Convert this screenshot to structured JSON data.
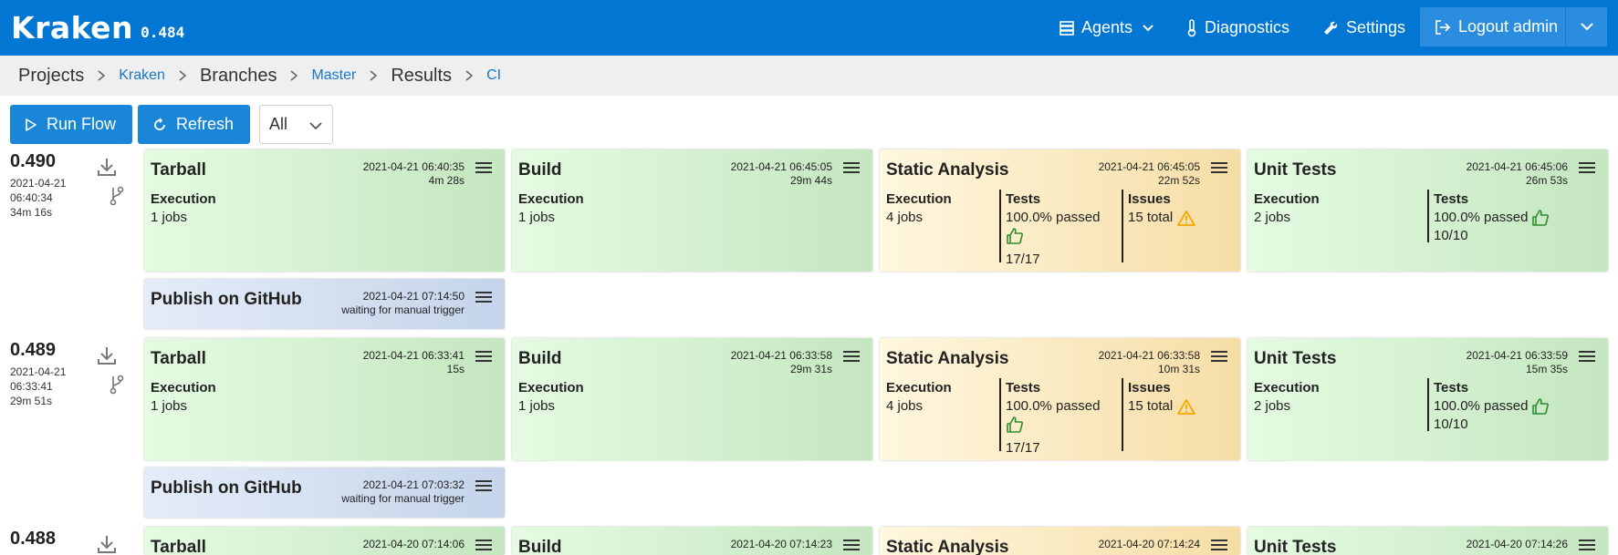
{
  "app": {
    "name": "Kraken",
    "version": "0.484"
  },
  "nav": {
    "agents": "Agents",
    "diagnostics": "Diagnostics",
    "settings": "Settings",
    "logout": "Logout admin"
  },
  "breadcrumb": {
    "projects": "Projects",
    "project": "Kraken",
    "branches": "Branches",
    "branch": "Master",
    "results": "Results",
    "flow": "CI"
  },
  "toolbar": {
    "run_flow": "Run Flow",
    "refresh": "Refresh",
    "filter": "All"
  },
  "flows": [
    {
      "label": "0.490",
      "date": "2021-04-21",
      "time": "06:40:34",
      "duration": "34m 16s",
      "tarball": {
        "title": "Tarball",
        "started": "2021-04-21 06:40:35",
        "duration": "4m 28s",
        "exec_label": "Execution",
        "jobs": "1 jobs"
      },
      "build": {
        "title": "Build",
        "started": "2021-04-21 06:45:05",
        "duration": "29m 44s",
        "exec_label": "Execution",
        "jobs": "1 jobs"
      },
      "static": {
        "title": "Static Analysis",
        "started": "2021-04-21 06:45:05",
        "duration": "22m 52s",
        "exec_label": "Execution",
        "jobs": "4 jobs",
        "tests_label": "Tests",
        "tests_passed": "100.0% passed",
        "tests_count": "17/17",
        "issues_label": "Issues",
        "issues_total": "15 total"
      },
      "unit": {
        "title": "Unit Tests",
        "started": "2021-04-21 06:45:06",
        "duration": "26m 53s",
        "exec_label": "Execution",
        "jobs": "2 jobs",
        "tests_label": "Tests",
        "tests_passed": "100.0% passed",
        "tests_count": "10/10"
      },
      "publish": {
        "title": "Publish on GitHub",
        "started": "2021-04-21 07:14:50",
        "status": "waiting for manual trigger"
      }
    },
    {
      "label": "0.489",
      "date": "2021-04-21",
      "time": "06:33:41",
      "duration": "29m 51s",
      "tarball": {
        "title": "Tarball",
        "started": "2021-04-21 06:33:41",
        "duration": "15s",
        "exec_label": "Execution",
        "jobs": "1 jobs"
      },
      "build": {
        "title": "Build",
        "started": "2021-04-21 06:33:58",
        "duration": "29m 31s",
        "exec_label": "Execution",
        "jobs": "1 jobs"
      },
      "static": {
        "title": "Static Analysis",
        "started": "2021-04-21 06:33:58",
        "duration": "10m 31s",
        "exec_label": "Execution",
        "jobs": "4 jobs",
        "tests_label": "Tests",
        "tests_passed": "100.0% passed",
        "tests_count": "17/17",
        "issues_label": "Issues",
        "issues_total": "15 total"
      },
      "unit": {
        "title": "Unit Tests",
        "started": "2021-04-21 06:33:59",
        "duration": "15m 35s",
        "exec_label": "Execution",
        "jobs": "2 jobs",
        "tests_label": "Tests",
        "tests_passed": "100.0% passed",
        "tests_count": "10/10"
      },
      "publish": {
        "title": "Publish on GitHub",
        "started": "2021-04-21 07:03:32",
        "status": "waiting for manual trigger"
      }
    },
    {
      "label": "0.488",
      "tarball": {
        "title": "Tarball",
        "started": "2021-04-20 07:14:06"
      },
      "build": {
        "title": "Build",
        "started": "2021-04-20 07:14:23"
      },
      "static": {
        "title": "Static Analysis",
        "started": "2021-04-20 07:14:24"
      },
      "unit": {
        "title": "Unit Tests",
        "started": "2021-04-20 07:14:26"
      }
    }
  ],
  "colors": {
    "header": "#0177d3",
    "button": "#1a86d8",
    "success": "#c4e6c0",
    "warning": "#f5dda5",
    "manual": "#c5d4ea",
    "warning_icon": "#f2a900",
    "thumb_icon": "#2e8b2e"
  },
  "icons": [
    "agents-icon",
    "thermometer-icon",
    "wrench-icon",
    "logout-icon",
    "play-icon",
    "refresh-icon",
    "download-icon",
    "branch-icon",
    "menu-icon",
    "thumbs-up-icon",
    "warning-icon",
    "chevron-down-icon",
    "chevron-right-icon"
  ]
}
